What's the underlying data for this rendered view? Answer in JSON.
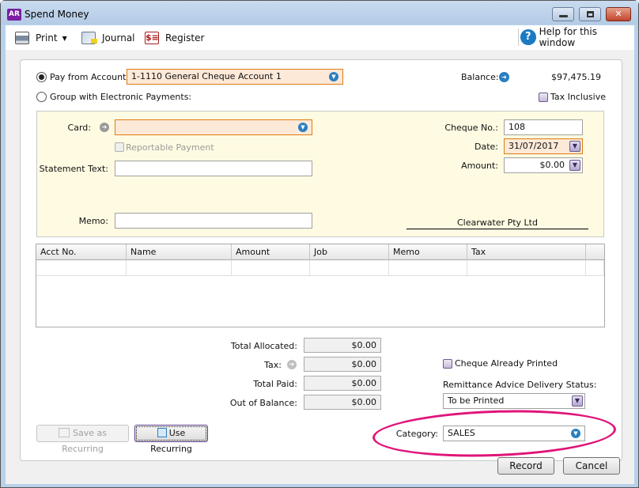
{
  "window": {
    "app_icon": "AR",
    "title": "Spend Money",
    "controls": [
      "minimize",
      "maximize",
      "close"
    ]
  },
  "toolbar": {
    "print_label": "Print",
    "journal_label": "Journal",
    "register_label": "Register",
    "help_label": "Help for this window"
  },
  "header": {
    "pay_from_label": "Pay from Account:",
    "pay_from_value": "1-1110 General Cheque Account 1",
    "pay_from_selected": true,
    "group_label": "Group with Electronic Payments:",
    "group_selected": false,
    "balance_label": "Balance:",
    "balance_value": "$97,475.19",
    "tax_inclusive_label": "Tax Inclusive",
    "tax_inclusive_checked": false
  },
  "cheque": {
    "card_label": "Card:",
    "card_value": "",
    "reportable_label": "Reportable Payment",
    "statement_label": "Statement Text:",
    "statement_value": "",
    "memo_label": "Memo:",
    "memo_value": "",
    "cheque_no_label": "Cheque No.:",
    "cheque_no_value": "108",
    "date_label": "Date:",
    "date_value": "31/07/2017",
    "amount_label": "Amount:",
    "amount_value": "$0.00",
    "payee_name": "Clearwater Pty Ltd"
  },
  "grid": {
    "columns": [
      "Acct No.",
      "Name",
      "Amount",
      "Job",
      "Memo",
      "Tax"
    ],
    "rows": []
  },
  "totals": {
    "allocated_label": "Total Allocated:",
    "allocated_value": "$0.00",
    "tax_label": "Tax:",
    "tax_value": "$0.00",
    "paid_label": "Total Paid:",
    "paid_value": "$0.00",
    "out_of_balance_label": "Out of Balance:",
    "out_of_balance_value": "$0.00"
  },
  "options": {
    "cheque_printed_label": "Cheque Already Printed",
    "cheque_printed_checked": false,
    "remittance_label": "Remittance Advice Delivery Status:",
    "remittance_value": "To be Printed",
    "category_label": "Category:",
    "category_value": "SALES"
  },
  "buttons": {
    "save_recurring": "Save as Recurring",
    "use_recurring": "Use Recurring",
    "record": "Record",
    "cancel": "Cancel"
  },
  "annotation": {
    "color": "#e0147a"
  }
}
